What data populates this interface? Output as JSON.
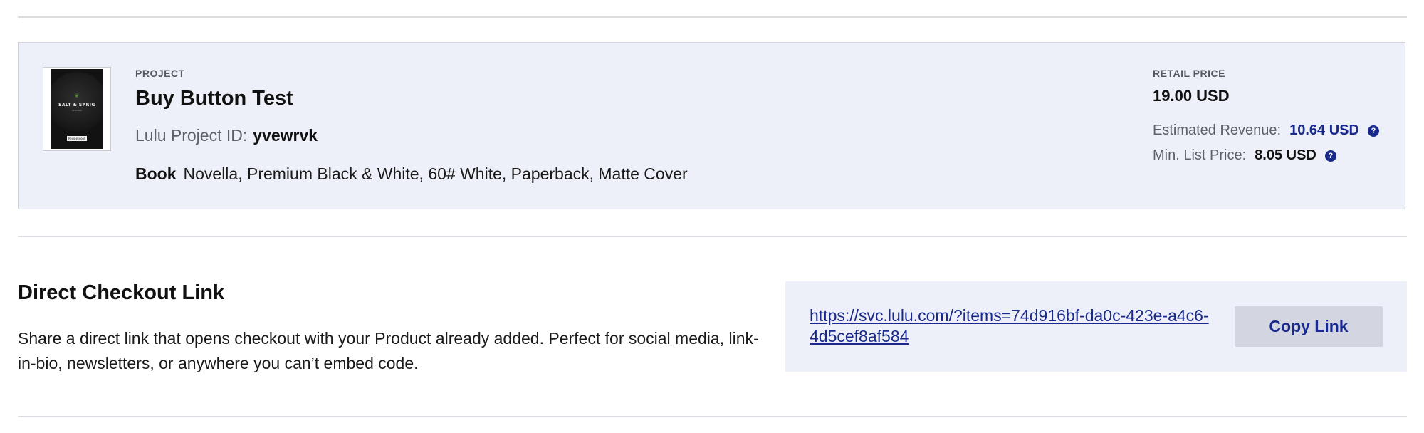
{
  "project": {
    "eyebrow": "PROJECT",
    "title": "Buy Button Test",
    "id_label": "Lulu Project ID:",
    "id_value": "yvewrvk",
    "type": "Book",
    "specs": "Novella, Premium Black & White, 60# White, Paperback, Matte Cover",
    "cover": {
      "title": "SALT & SPRIG",
      "subtitle": "KITCHEN",
      "label": "Recipe Book"
    }
  },
  "pricing": {
    "eyebrow": "RETAIL PRICE",
    "retail_price": "19.00 USD",
    "revenue_label": "Estimated Revenue:",
    "revenue_value": "10.64 USD",
    "min_label": "Min. List Price:",
    "min_value": "8.05 USD",
    "help_glyph": "?"
  },
  "checkout": {
    "title": "Direct Checkout Link",
    "description": "Share a direct link that opens checkout with your Product already added. Perfect for social media, link-in-bio, newsletters, or anywhere you can’t embed code.",
    "url": "https://svc.lulu.com/?items=74d916bf-da0c-423e-a4c6-4d5cef8af584",
    "copy_label": "Copy Link"
  },
  "colors": {
    "accent": "#1a2a8c",
    "panel_background": "#eef0f9",
    "button_background": "#d3d6e0"
  }
}
